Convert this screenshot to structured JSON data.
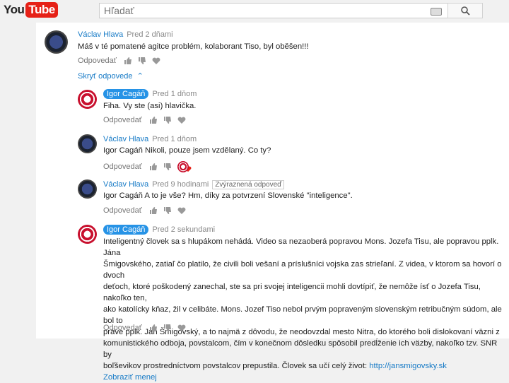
{
  "logo": {
    "you": "You",
    "tube": "Tube"
  },
  "search": {
    "placeholder": "Hľadať"
  },
  "comments": [
    {
      "author": "Václav Hlava",
      "time": "Pred 2 dňami",
      "text": "Máš v té pomatené agitce problém, kolaborant Tiso, byl oběšen!!!",
      "reply": "Odpovedať"
    },
    {
      "author": "Igor Cagáň",
      "time": "Pred 1 dňom",
      "text": "Fiha. Vy ste (asi) hlavička.",
      "reply": "Odpovedať"
    },
    {
      "author": "Václav Hlava",
      "time": "Pred 1 dňom",
      "text": "Igor Cagáň Nikoli, pouze jsem vzdělaný. Co ty?",
      "reply": "Odpovedať"
    },
    {
      "author": "Václav Hlava",
      "time": "Pred 9 hodinami",
      "tag": "Zvýraznená odpoveď",
      "text": "Igor Cagáň A to je vše? Hm, díky za potvrzení Slovenské \"inteligence\".",
      "reply": "Odpovedať"
    },
    {
      "author": "Igor Cagáň",
      "time": "Pred 2 sekundami",
      "lines": [
        "Inteligentný človek sa s hlupákom nehádá. Video sa nezaoberá popravou Mons. Jozefa Tisu, ale popravou pplk. Jána",
        "Šmigovského, zatiaľ čo platilo, že civili boli vešaní a príslušníci vojska zas strieľaní. Z videa, v ktorom sa hovorí o dvoch",
        "deťoch, ktoré poškodený zanechal, ste sa pri svojej inteligencii mohli dovtípiť, že nemôže ísť o Jozefa Tisu, nakoľko ten,",
        "ako katolícky kňaz, žil v celibáte. Mons. Jozef Tiso nebol prvým popraveným slovenským retribučným súdom, ale bol to",
        "práve pplk. Ján Šmigovský, a to najmä z dôvodu, že neodovzdal mesto Nitra, do ktorého boli dislokovaní väzni z",
        "komunistického odboja, povstalcom, čím v konečnom dôsledku spôsobil predĺženie ich väzby, nakoľko tzv. SNR by",
        "boľševikov prostredníctvom povstalcov prepustila. Človek sa učí celý život: "
      ],
      "link": "http://jansmigovsky.sk",
      "show_less": "Zobraziť menej",
      "reply": "Odpovedať"
    }
  ],
  "hide_replies": "Skryť odpovede"
}
